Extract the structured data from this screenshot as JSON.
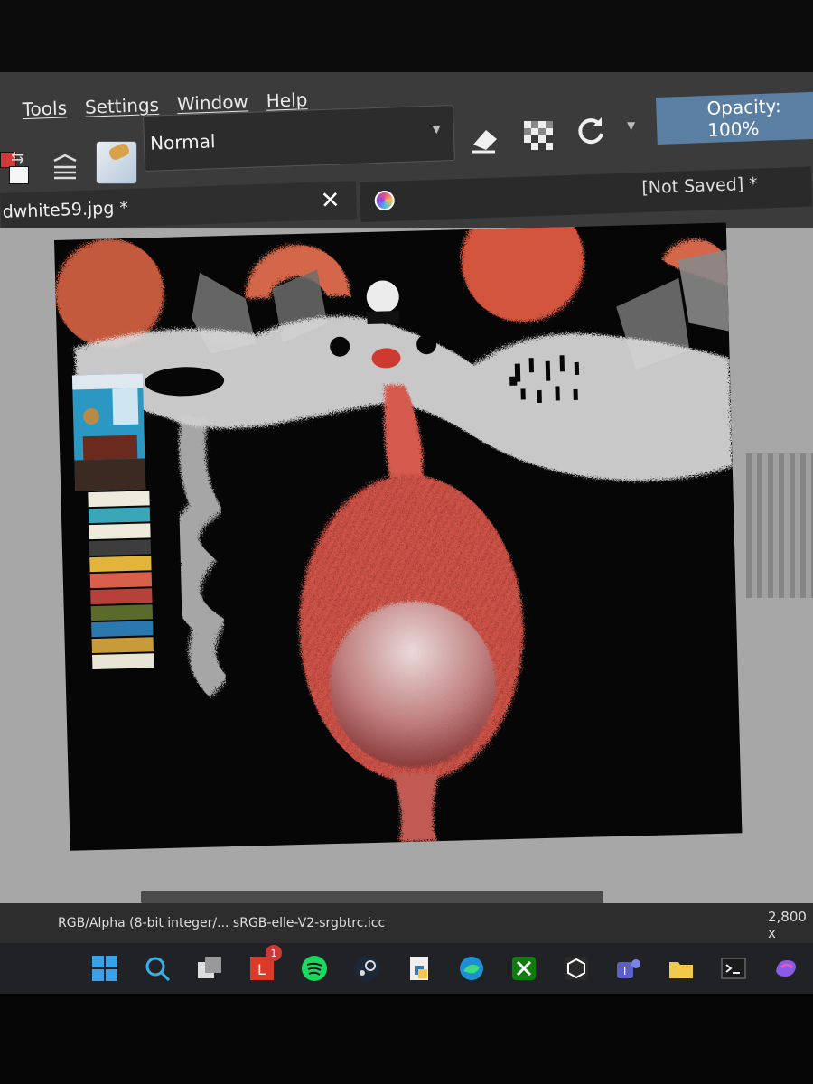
{
  "menu": {
    "tools": "Tools",
    "settings": "Settings",
    "window": "Window",
    "help": "Help"
  },
  "toolbar": {
    "blend_mode": "Normal",
    "opacity_label": "Opacity: 100%"
  },
  "tabs": {
    "document_title": "dwhite59.jpg *",
    "second_tab_status": "[Not Saved]  *"
  },
  "status": {
    "color_profile": "RGB/Alpha (8-bit integer/... sRGB-elle-V2-srgbtrc.icc",
    "image_size": "2,800 x"
  },
  "taskbar": {
    "notification_count": "1",
    "apps": [
      "start-icon",
      "search-icon",
      "task-view-icon",
      "library-icon",
      "spotify-icon",
      "steam-icon",
      "python-file-icon",
      "edge-icon",
      "xbox-icon",
      "unity-icon",
      "teams-icon",
      "file-explorer-icon",
      "terminal-icon",
      "copilot-icon"
    ]
  },
  "colors": {
    "accent_opacity": "#5b7fa3",
    "fg_color": "#d23a3a",
    "bg_color": "#f5f5f5",
    "palette_swatches": [
      "#eeeadc",
      "#3aa6b8",
      "#eeeadc",
      "#3d3d3d",
      "#e3b43a",
      "#d8604a",
      "#b8403a",
      "#5a6a2a",
      "#2a78b0",
      "#c89a3a",
      "#e8e4d6"
    ]
  }
}
